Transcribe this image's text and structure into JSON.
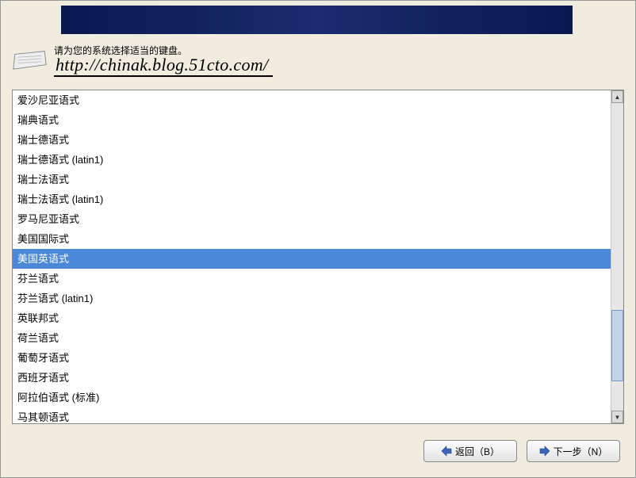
{
  "prompt": "请为您的系统选择适当的键盘。",
  "watermark": "http://chinak.blog.51cto.com/",
  "keyboard_list": {
    "items": [
      {
        "label": "爱沙尼亚语式",
        "selected": false
      },
      {
        "label": "瑞典语式",
        "selected": false
      },
      {
        "label": "瑞士德语式",
        "selected": false
      },
      {
        "label": "瑞士德语式 (latin1)",
        "selected": false
      },
      {
        "label": "瑞士法语式",
        "selected": false
      },
      {
        "label": "瑞士法语式 (latin1)",
        "selected": false
      },
      {
        "label": "罗马尼亚语式",
        "selected": false
      },
      {
        "label": "美国国际式",
        "selected": false
      },
      {
        "label": "美国英语式",
        "selected": true
      },
      {
        "label": "芬兰语式",
        "selected": false
      },
      {
        "label": "芬兰语式 (latin1)",
        "selected": false
      },
      {
        "label": "英联邦式",
        "selected": false
      },
      {
        "label": "荷兰语式",
        "selected": false
      },
      {
        "label": "葡萄牙语式",
        "selected": false
      },
      {
        "label": "西班牙语式",
        "selected": false
      },
      {
        "label": "阿拉伯语式 (标准)",
        "selected": false
      },
      {
        "label": "马其顿语式",
        "selected": false
      }
    ],
    "scroll_thumb": {
      "top_pct": 67,
      "height_pct": 23
    }
  },
  "buttons": {
    "back": "返回（B）",
    "next": "下一步（N）"
  },
  "icons": {
    "arrow_left": "⬅",
    "arrow_right": "➡",
    "scroll_up": "▲",
    "scroll_down": "▼"
  }
}
